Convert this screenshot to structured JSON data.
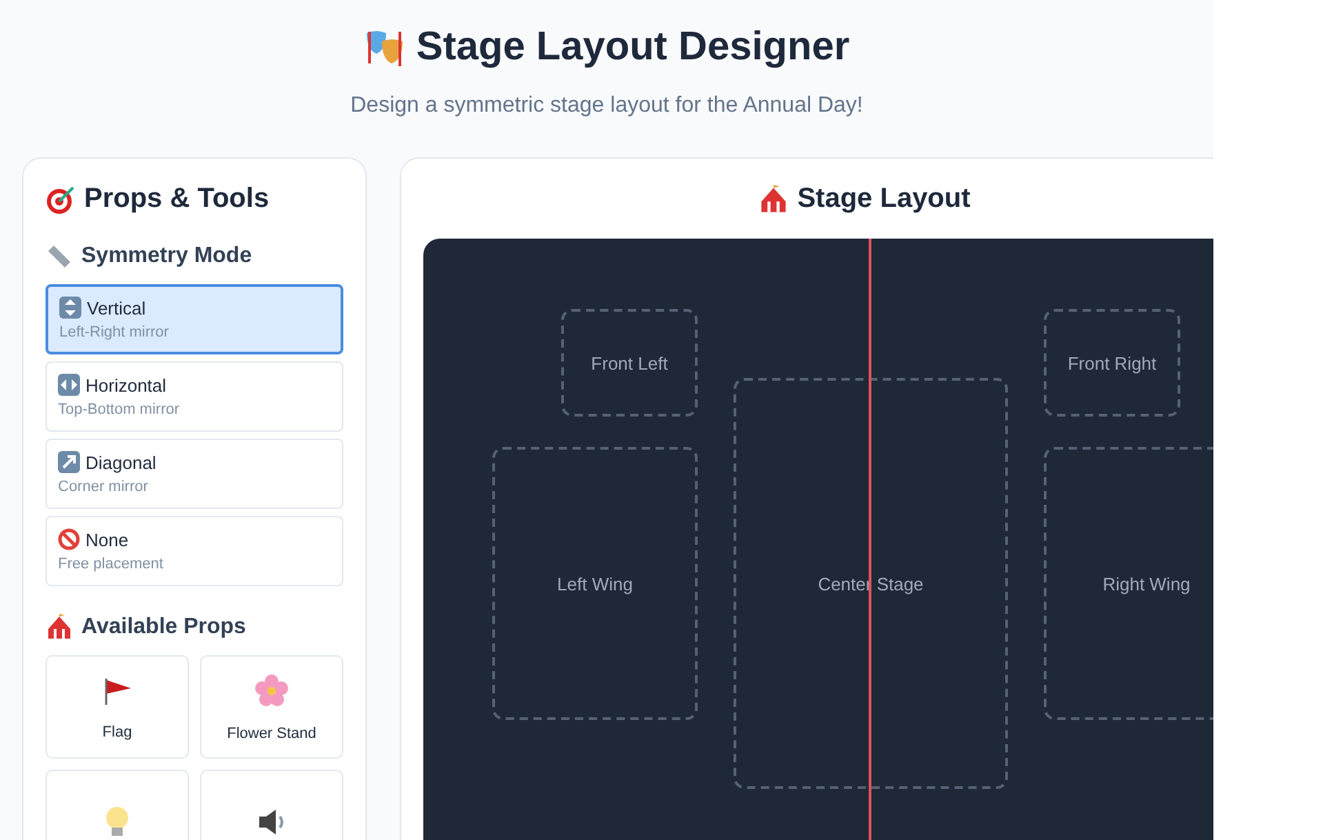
{
  "header": {
    "title": "Stage Layout Designer",
    "subtitle": "Design a symmetric stage layout for the Annual Day!"
  },
  "sidebar": {
    "title": "Props & Tools",
    "symmetry_title": "Symmetry Mode",
    "modes": [
      {
        "kind": "vertical",
        "label": "Vertical",
        "hint": "Left-Right mirror",
        "selected": true
      },
      {
        "kind": "horizontal",
        "label": "Horizontal",
        "hint": "Top-Bottom mirror",
        "selected": false
      },
      {
        "kind": "diagonal",
        "label": "Diagonal",
        "hint": "Corner mirror",
        "selected": false
      },
      {
        "kind": "none",
        "label": "None",
        "hint": "Free placement",
        "selected": false
      }
    ],
    "props_title": "Available Props",
    "props": [
      {
        "kind": "flag",
        "label": "Flag"
      },
      {
        "kind": "flower",
        "label": "Flower Stand"
      },
      {
        "kind": "bulb"
      },
      {
        "kind": "speaker"
      }
    ]
  },
  "stage": {
    "title": "Stage Layout",
    "zones": [
      {
        "label": "Front Left"
      },
      {
        "label": "Front Right"
      },
      {
        "label": "Left Wing"
      },
      {
        "label": "Center Stage"
      },
      {
        "label": "Right Wing"
      }
    ]
  }
}
